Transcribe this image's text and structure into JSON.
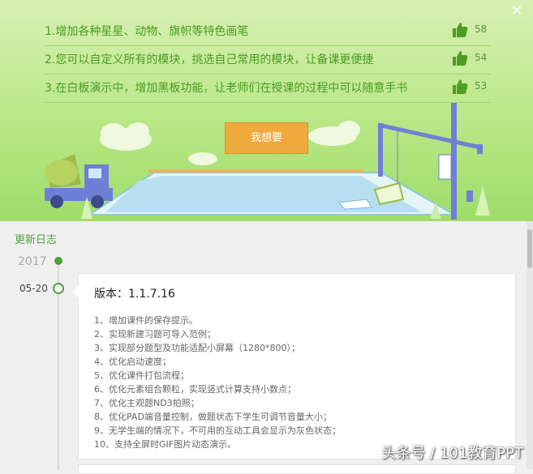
{
  "banner": {
    "close_symbol": "✕",
    "features": [
      {
        "text": "1.增加各种星星、动物、旗帜等特色画笔",
        "likes": "58"
      },
      {
        "text": "2.您可以自定义所有的模块，挑选自己常用的模块，让备课更便捷",
        "likes": "54"
      },
      {
        "text": "3.在白板演示中，增加黑板功能，让老师们在授课的过程中可以随意手书",
        "likes": "53"
      }
    ],
    "button_label": "我想要"
  },
  "log": {
    "title": "更新日志",
    "year": "2017",
    "date": "05-20",
    "version": "版本：1.1.7.16",
    "changes": [
      "1、增加课件的保存提示。",
      "2、实现新建习题可导入范例；",
      "3、实现部分题型及功能适配小屏幕（1280*800）；",
      "4、优化启动速度；",
      "5、优化课件打包流程；",
      "6、优化元素组合颗粒，实现竖式计算支持小数点；",
      "7、优化主观题ND3拍照；",
      "8、优化PAD端音量控制，做题状态下学生可调节音量大小；",
      "9、无学生端的情况下，不可用的互动工具会显示为灰色状态；",
      "10、支持全屏时GIF图片动态演示。"
    ]
  },
  "watermark": "头条号 / 101教育PPT",
  "colors": {
    "accent_green": "#4da23a",
    "button_orange": "#efaa3c",
    "banner_green": "#b9e786"
  }
}
